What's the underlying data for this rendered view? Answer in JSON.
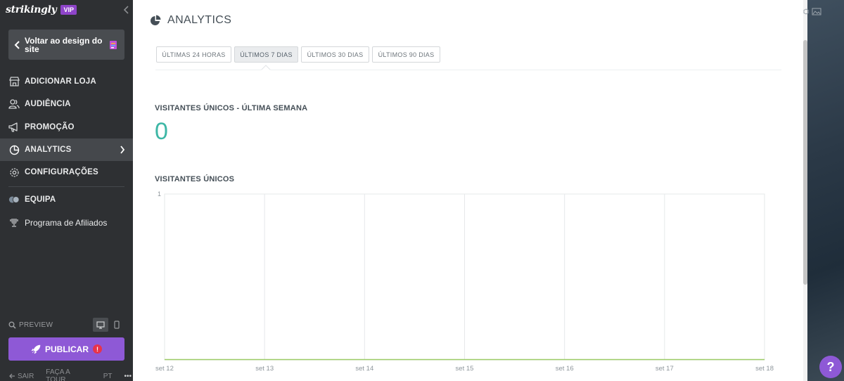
{
  "sidebar": {
    "brand": "strikingly",
    "vip": "VIP",
    "back_label": "Voltar ao design do site",
    "items": [
      {
        "label": "ADICIONAR LOJA"
      },
      {
        "label": "AUDIÊNCIA"
      },
      {
        "label": "PROMOÇÃO"
      },
      {
        "label": "ANALYTICS"
      },
      {
        "label": "CONFIGURAÇÕES"
      },
      {
        "label": "EQUIPA"
      },
      {
        "label": "Programa de Afiliados"
      }
    ],
    "preview_label": "PREVIEW",
    "publish_label": "PUBLICAR",
    "publish_alert": "!",
    "footer": {
      "exit": "SAIR",
      "tour": "FAÇA A TOUR",
      "lang": "PT",
      "more": "•••"
    }
  },
  "main": {
    "title": "ANALYTICS",
    "tabs": [
      {
        "label": "ÚLTIMAS 24 HORAS",
        "active": false
      },
      {
        "label": "ÚLTIMOS 7 DIAS",
        "active": true
      },
      {
        "label": "ÚLTIMOS 30 DIAS",
        "active": false
      },
      {
        "label": "ÚLTIMOS 90 DIAS",
        "active": false
      }
    ],
    "unique_week_label": "VISITANTES ÚNICOS - ÚLTIMA SEMANA",
    "unique_week_value": "0",
    "unique_chart_label": "VISITANTES ÚNICOS"
  },
  "help": {
    "label": "?"
  },
  "colors": {
    "accent": "#8e59d6",
    "count": "#3eb7a6",
    "line": "#9ccc65",
    "sidebar": "#2e3033"
  },
  "chart_data": {
    "type": "line",
    "categories": [
      "set 12",
      "set 13",
      "set 14",
      "set 15",
      "set 16",
      "set 17",
      "set 18"
    ],
    "series": [
      {
        "values": [
          0,
          0,
          0,
          0,
          0,
          0,
          0
        ]
      }
    ],
    "ylim": [
      0,
      1
    ],
    "yticks": [
      "1"
    ],
    "grid": true
  }
}
